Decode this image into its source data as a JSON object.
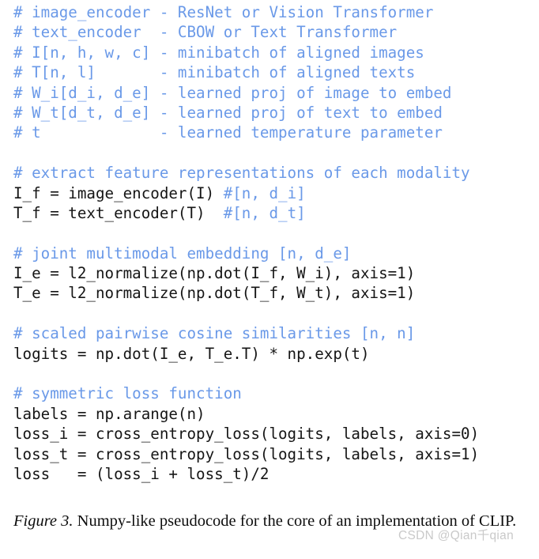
{
  "figure": {
    "kind": "pseudocode-listing",
    "background_color": "#ffffff",
    "comment_color": "#6a99e8",
    "code_color": "#151515",
    "caption_color": "#0d0d0d",
    "watermark_color": "#c9c9c9"
  },
  "code": {
    "language": "numpy-like pseudocode",
    "lines": [
      {
        "id": "l01",
        "comment": "# image_encoder - ResNet or Vision Transformer",
        "code": ""
      },
      {
        "id": "l02",
        "comment": "# text_encoder  - CBOW or Text Transformer",
        "code": ""
      },
      {
        "id": "l03",
        "comment": "# I[n, h, w, c] - minibatch of aligned images",
        "code": ""
      },
      {
        "id": "l04",
        "comment": "# T[n, l]       - minibatch of aligned texts",
        "code": ""
      },
      {
        "id": "l05",
        "comment": "# W_i[d_i, d_e] - learned proj of image to embed",
        "code": ""
      },
      {
        "id": "l06",
        "comment": "# W_t[d_t, d_e] - learned proj of text to embed",
        "code": ""
      },
      {
        "id": "l07",
        "comment": "# t             - learned temperature parameter",
        "code": ""
      },
      {
        "id": "l08",
        "comment": "",
        "code": ""
      },
      {
        "id": "l09",
        "comment": "# extract feature representations of each modality",
        "code": ""
      },
      {
        "id": "l10",
        "comment": "#[n, d_i]",
        "code": "I_f = image_encoder(I) "
      },
      {
        "id": "l11",
        "comment": "#[n, d_t]",
        "code": "T_f = text_encoder(T)  "
      },
      {
        "id": "l12",
        "comment": "",
        "code": ""
      },
      {
        "id": "l13",
        "comment": "# joint multimodal embedding [n, d_e]",
        "code": ""
      },
      {
        "id": "l14",
        "comment": "",
        "code": "I_e = l2_normalize(np.dot(I_f, W_i), axis=1)"
      },
      {
        "id": "l15",
        "comment": "",
        "code": "T_e = l2_normalize(np.dot(T_f, W_t), axis=1)"
      },
      {
        "id": "l16",
        "comment": "",
        "code": ""
      },
      {
        "id": "l17",
        "comment": "# scaled pairwise cosine similarities [n, n]",
        "code": ""
      },
      {
        "id": "l18",
        "comment": "",
        "code": "logits = np.dot(I_e, T_e.T) * np.exp(t)"
      },
      {
        "id": "l19",
        "comment": "",
        "code": ""
      },
      {
        "id": "l20",
        "comment": "# symmetric loss function",
        "code": ""
      },
      {
        "id": "l21",
        "comment": "",
        "code": "labels = np.arange(n)"
      },
      {
        "id": "l22",
        "comment": "",
        "code": "loss_i = cross_entropy_loss(logits, labels, axis=0)"
      },
      {
        "id": "l23",
        "comment": "",
        "code": "loss_t = cross_entropy_loss(logits, labels, axis=1)"
      },
      {
        "id": "l24",
        "comment": "",
        "code": "loss   = (loss_i + loss_t)/2"
      }
    ]
  },
  "caption": {
    "label": "Figure 3.",
    "text": " Numpy-like pseudocode for the core of an implementation of CLIP."
  },
  "watermark": {
    "text": "CSDN @Qian千qian"
  }
}
